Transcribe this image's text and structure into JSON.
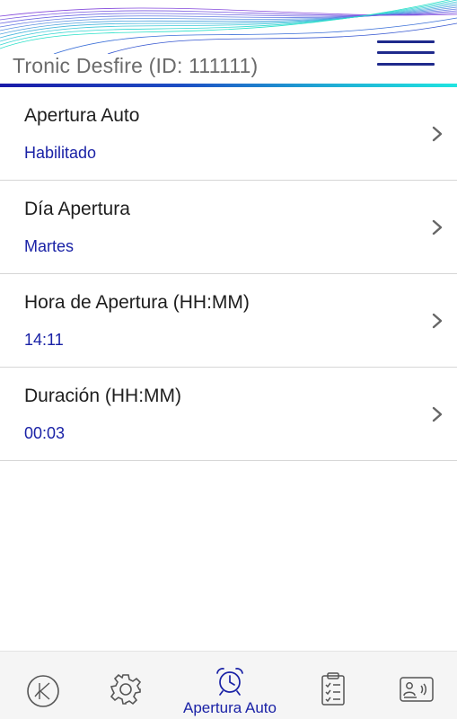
{
  "header": {
    "title": "Tronic Desfire (ID: 111111)",
    "menu_icon": "hamburger-menu-icon",
    "accent_color": "#1f2a8c",
    "gradient_colors": [
      "#1a1aa8",
      "#20e4e0"
    ]
  },
  "settings": [
    {
      "label": "Apertura Auto",
      "value": "Habilitado"
    },
    {
      "label": "Día Apertura",
      "value": "Martes"
    },
    {
      "label": "Hora de Apertura (HH:MM)",
      "value": "14:11"
    },
    {
      "label": "Duración (HH:MM)",
      "value": "00:03"
    }
  ],
  "bottom_nav": {
    "items": [
      {
        "icon": "brand-logo-icon"
      },
      {
        "icon": "gear-icon"
      },
      {
        "icon": "alarm-clock-icon",
        "label": "Apertura Auto",
        "active": true
      },
      {
        "icon": "clipboard-checklist-icon"
      },
      {
        "icon": "id-card-nfc-icon"
      }
    ],
    "active_color": "#1a22a6",
    "icon_color": "#555555"
  }
}
